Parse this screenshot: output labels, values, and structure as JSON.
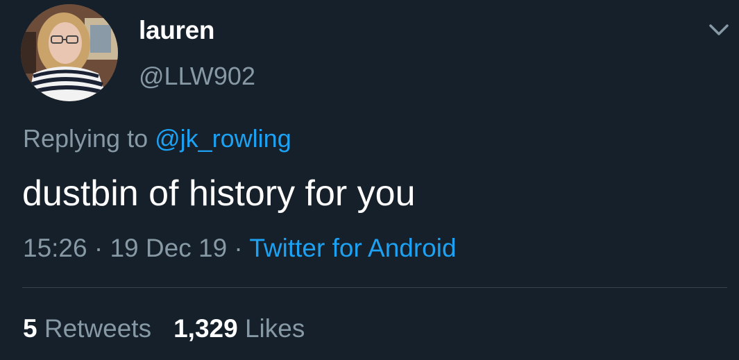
{
  "user": {
    "display_name": "lauren",
    "handle": "@LLW902"
  },
  "reply": {
    "prefix": "Replying to ",
    "mention": "@jk_rowling"
  },
  "tweet": {
    "text": "dustbin of history for you"
  },
  "meta": {
    "time": "15:26",
    "separator": " · ",
    "date": "19 Dec 19",
    "source": "Twitter for Android"
  },
  "stats": {
    "retweets_count": "5",
    "retweets_label": " Retweets",
    "likes_count": "1,329",
    "likes_label": " Likes"
  },
  "icons": {
    "menu": "chevron-down-icon",
    "avatar": "avatar"
  },
  "colors": {
    "background": "#15202b",
    "primary_text": "#ffffff",
    "secondary_text": "#8899a6",
    "link": "#1da1f2",
    "divider": "#38444d"
  }
}
